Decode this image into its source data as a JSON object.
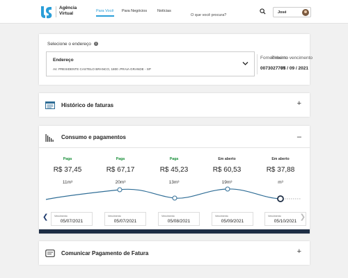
{
  "header": {
    "brand_line1": "Agência",
    "brand_line2": "Virtual",
    "nav": [
      {
        "label": "Para Você",
        "active": true
      },
      {
        "label": "Para Negócios",
        "active": false
      },
      {
        "label": "Notícias",
        "active": false
      }
    ],
    "search_placeholder": "O que você procura?",
    "user_name": "José"
  },
  "address_card": {
    "title": "Selecione o endereço",
    "select_label": "Endereço",
    "select_value": "AV. PRESIDENTE CASTELO BRANCO, 1800 .PRAIA GRANDE - SP",
    "supply_label": "Fornecimento",
    "supply_value": "0073027707",
    "next_due_label": "Próximo vencimento",
    "next_due_value": "05 / 09 / 2021"
  },
  "history_card": {
    "title": "Histórico de faturas"
  },
  "consumption_card": {
    "title": "Consumo e pagamentos",
    "due_label": "Vencimento",
    "months": [
      {
        "status": "Paga",
        "amount": "R$ 37,45",
        "usage": "11m³",
        "due": "05/07/2021"
      },
      {
        "status": "Paga",
        "amount": "R$ 67,17",
        "usage": "20m³",
        "due": "05/07/2021"
      },
      {
        "status": "Paga",
        "amount": "R$ 45,23",
        "usage": "13m³",
        "due": "05/08/2021"
      },
      {
        "status": "Em aberto",
        "amount": "R$ 60,53",
        "usage": "19m³",
        "due": "05/09/2021"
      },
      {
        "status": "Em aberto",
        "amount": "R$ 37,88",
        "usage": "m³",
        "due": "05/10/2021"
      }
    ]
  },
  "payment_card": {
    "title": "Comunicar Pagamento de Fatura"
  },
  "colors": {
    "accent": "#2a9ed8",
    "paid": "#1a8f3a",
    "dark_bar": "#1e2e45",
    "line": "#2f6d96"
  }
}
